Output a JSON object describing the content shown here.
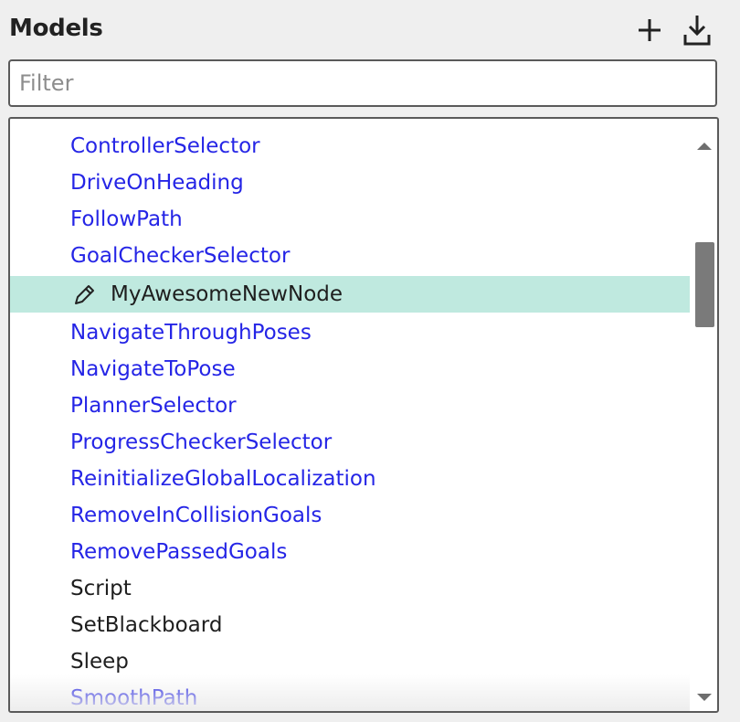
{
  "panel": {
    "title": "Models",
    "add_icon": "plus-icon",
    "import_icon": "download-icon"
  },
  "filter": {
    "placeholder": "Filter",
    "value": ""
  },
  "colors": {
    "link_blue": "#2525e6",
    "selected_row": "#bfe9df",
    "scrollbar_thumb": "#7a7a7a"
  },
  "models": [
    {
      "label": "ControllerSelector"
    },
    {
      "label": "DriveOnHeading"
    },
    {
      "label": "FollowPath"
    },
    {
      "label": "GoalCheckerSelector"
    },
    {
      "label": "MyAwesomeNewNode"
    },
    {
      "label": "NavigateThroughPoses"
    },
    {
      "label": "NavigateToPose"
    },
    {
      "label": "PlannerSelector"
    },
    {
      "label": "ProgressCheckerSelector"
    },
    {
      "label": "ReinitializeGlobalLocalization"
    },
    {
      "label": "RemoveInCollisionGoals"
    },
    {
      "label": "RemovePassedGoals"
    },
    {
      "label": "Script"
    },
    {
      "label": "SetBlackboard"
    },
    {
      "label": "Sleep"
    },
    {
      "label": "SmoothPath"
    }
  ]
}
